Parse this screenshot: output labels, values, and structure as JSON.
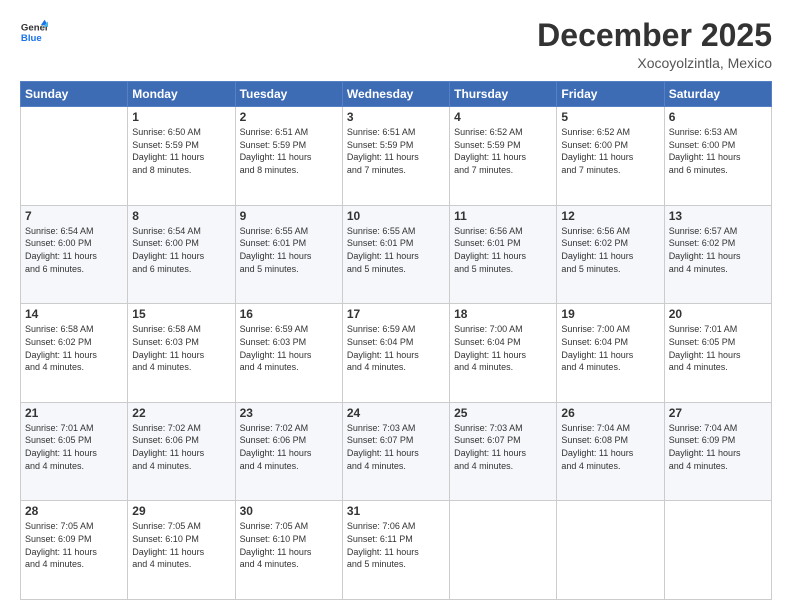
{
  "header": {
    "logo_line1": "General",
    "logo_line2": "Blue",
    "main_title": "December 2025",
    "subtitle": "Xocoyolzintla, Mexico"
  },
  "days_of_week": [
    "Sunday",
    "Monday",
    "Tuesday",
    "Wednesday",
    "Thursday",
    "Friday",
    "Saturday"
  ],
  "weeks": [
    [
      {
        "day": "",
        "data": ""
      },
      {
        "day": "1",
        "data": "Sunrise: 6:50 AM\nSunset: 5:59 PM\nDaylight: 11 hours\nand 8 minutes."
      },
      {
        "day": "2",
        "data": "Sunrise: 6:51 AM\nSunset: 5:59 PM\nDaylight: 11 hours\nand 8 minutes."
      },
      {
        "day": "3",
        "data": "Sunrise: 6:51 AM\nSunset: 5:59 PM\nDaylight: 11 hours\nand 7 minutes."
      },
      {
        "day": "4",
        "data": "Sunrise: 6:52 AM\nSunset: 5:59 PM\nDaylight: 11 hours\nand 7 minutes."
      },
      {
        "day": "5",
        "data": "Sunrise: 6:52 AM\nSunset: 6:00 PM\nDaylight: 11 hours\nand 7 minutes."
      },
      {
        "day": "6",
        "data": "Sunrise: 6:53 AM\nSunset: 6:00 PM\nDaylight: 11 hours\nand 6 minutes."
      }
    ],
    [
      {
        "day": "7",
        "data": "Sunrise: 6:54 AM\nSunset: 6:00 PM\nDaylight: 11 hours\nand 6 minutes."
      },
      {
        "day": "8",
        "data": "Sunrise: 6:54 AM\nSunset: 6:00 PM\nDaylight: 11 hours\nand 6 minutes."
      },
      {
        "day": "9",
        "data": "Sunrise: 6:55 AM\nSunset: 6:01 PM\nDaylight: 11 hours\nand 5 minutes."
      },
      {
        "day": "10",
        "data": "Sunrise: 6:55 AM\nSunset: 6:01 PM\nDaylight: 11 hours\nand 5 minutes."
      },
      {
        "day": "11",
        "data": "Sunrise: 6:56 AM\nSunset: 6:01 PM\nDaylight: 11 hours\nand 5 minutes."
      },
      {
        "day": "12",
        "data": "Sunrise: 6:56 AM\nSunset: 6:02 PM\nDaylight: 11 hours\nand 5 minutes."
      },
      {
        "day": "13",
        "data": "Sunrise: 6:57 AM\nSunset: 6:02 PM\nDaylight: 11 hours\nand 4 minutes."
      }
    ],
    [
      {
        "day": "14",
        "data": "Sunrise: 6:58 AM\nSunset: 6:02 PM\nDaylight: 11 hours\nand 4 minutes."
      },
      {
        "day": "15",
        "data": "Sunrise: 6:58 AM\nSunset: 6:03 PM\nDaylight: 11 hours\nand 4 minutes."
      },
      {
        "day": "16",
        "data": "Sunrise: 6:59 AM\nSunset: 6:03 PM\nDaylight: 11 hours\nand 4 minutes."
      },
      {
        "day": "17",
        "data": "Sunrise: 6:59 AM\nSunset: 6:04 PM\nDaylight: 11 hours\nand 4 minutes."
      },
      {
        "day": "18",
        "data": "Sunrise: 7:00 AM\nSunset: 6:04 PM\nDaylight: 11 hours\nand 4 minutes."
      },
      {
        "day": "19",
        "data": "Sunrise: 7:00 AM\nSunset: 6:04 PM\nDaylight: 11 hours\nand 4 minutes."
      },
      {
        "day": "20",
        "data": "Sunrise: 7:01 AM\nSunset: 6:05 PM\nDaylight: 11 hours\nand 4 minutes."
      }
    ],
    [
      {
        "day": "21",
        "data": "Sunrise: 7:01 AM\nSunset: 6:05 PM\nDaylight: 11 hours\nand 4 minutes."
      },
      {
        "day": "22",
        "data": "Sunrise: 7:02 AM\nSunset: 6:06 PM\nDaylight: 11 hours\nand 4 minutes."
      },
      {
        "day": "23",
        "data": "Sunrise: 7:02 AM\nSunset: 6:06 PM\nDaylight: 11 hours\nand 4 minutes."
      },
      {
        "day": "24",
        "data": "Sunrise: 7:03 AM\nSunset: 6:07 PM\nDaylight: 11 hours\nand 4 minutes."
      },
      {
        "day": "25",
        "data": "Sunrise: 7:03 AM\nSunset: 6:07 PM\nDaylight: 11 hours\nand 4 minutes."
      },
      {
        "day": "26",
        "data": "Sunrise: 7:04 AM\nSunset: 6:08 PM\nDaylight: 11 hours\nand 4 minutes."
      },
      {
        "day": "27",
        "data": "Sunrise: 7:04 AM\nSunset: 6:09 PM\nDaylight: 11 hours\nand 4 minutes."
      }
    ],
    [
      {
        "day": "28",
        "data": "Sunrise: 7:05 AM\nSunset: 6:09 PM\nDaylight: 11 hours\nand 4 minutes."
      },
      {
        "day": "29",
        "data": "Sunrise: 7:05 AM\nSunset: 6:10 PM\nDaylight: 11 hours\nand 4 minutes."
      },
      {
        "day": "30",
        "data": "Sunrise: 7:05 AM\nSunset: 6:10 PM\nDaylight: 11 hours\nand 4 minutes."
      },
      {
        "day": "31",
        "data": "Sunrise: 7:06 AM\nSunset: 6:11 PM\nDaylight: 11 hours\nand 5 minutes."
      },
      {
        "day": "",
        "data": ""
      },
      {
        "day": "",
        "data": ""
      },
      {
        "day": "",
        "data": ""
      }
    ]
  ]
}
